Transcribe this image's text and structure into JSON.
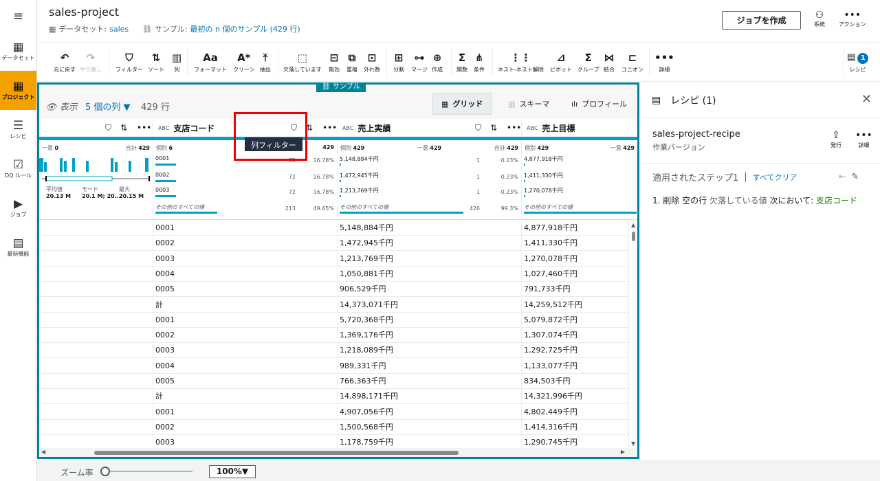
{
  "nav": {
    "items": [
      {
        "icon": "▦",
        "label": "データセット"
      },
      {
        "icon": "▦",
        "label": "プロジェクト"
      },
      {
        "icon": "☰",
        "label": "レシピ"
      },
      {
        "icon": "☑",
        "label": "DQ ルール"
      },
      {
        "icon": "▶",
        "label": "ジョブ"
      },
      {
        "icon": "▤",
        "label": "最新機能"
      }
    ]
  },
  "header": {
    "title": "sales-project",
    "dataset_label": "データセット:",
    "dataset_value": "sales",
    "sample_label": "サンプル:",
    "sample_value": "最初の n 個のサンプル (429 行)",
    "create_job": "ジョブを作成",
    "lineage": "系統",
    "actions": "アクション"
  },
  "toolbar": {
    "items": [
      {
        "icon": "↶",
        "label": "元に戻す"
      },
      {
        "icon": "↷",
        "label": "やり直し"
      },
      {
        "icon": "⛉",
        "label": "フィルター"
      },
      {
        "icon": "⇅",
        "label": "ソート"
      },
      {
        "icon": "▥",
        "label": "列"
      },
      {
        "icon": "Aa",
        "label": "フォーマット"
      },
      {
        "icon": "A*",
        "label": "クリーン"
      },
      {
        "icon": "⤒",
        "label": "抽出"
      },
      {
        "icon": "⬚",
        "label": "欠落しています"
      },
      {
        "icon": "⊟",
        "label": "無効"
      },
      {
        "icon": "⧉",
        "label": "重複"
      },
      {
        "icon": "⊡",
        "label": "外れ数"
      },
      {
        "icon": "⊞",
        "label": "分割"
      },
      {
        "icon": "⊶",
        "label": "マージ"
      },
      {
        "icon": "⊕",
        "label": "作成"
      },
      {
        "icon": "Σ",
        "label": "関数"
      },
      {
        "icon": "⋔",
        "label": "条件"
      },
      {
        "icon": "⋮⋮",
        "label": "ネスト-ネスト解除"
      },
      {
        "icon": "⊿",
        "label": "ピボット"
      },
      {
        "icon": "Σ",
        "label": "グループ"
      },
      {
        "icon": "⋈",
        "label": "結合"
      },
      {
        "icon": "⊏",
        "label": "ユニオン"
      },
      {
        "icon": "•••",
        "label": "詳細"
      }
    ],
    "recipe_label": "レシピ",
    "recipe_count": "1"
  },
  "sample_tag": "サンプル",
  "view": {
    "show": "表示",
    "columns": "5 個の列 ▼",
    "rows": "429 行",
    "tabs": [
      "グリッド",
      "スキーマ",
      "プロフィール"
    ]
  },
  "columns": [
    {
      "name": "",
      "type": ""
    },
    {
      "name": "支店コード",
      "type": "ABC"
    },
    {
      "name": "売上実績",
      "type": "ABC"
    },
    {
      "name": "売上目標",
      "type": "ABC"
    }
  ],
  "stats": {
    "col0": {
      "unique_label": "一意",
      "unique": "0",
      "total_label": "合計",
      "total": "429",
      "avg_label": "平均値",
      "avg": "20.13 M",
      "mode_label": "モード",
      "mode": "20.1 M; 20....",
      "max_label": "最大",
      "max": "20.15 M"
    },
    "col1": {
      "distinct_label": "個別",
      "distinct": "6",
      "unique_label": "一",
      "total": "429",
      "values": [
        {
          "v": "0001",
          "c": "72",
          "p": "16.78%",
          "w": 30
        },
        {
          "v": "0002",
          "c": "72",
          "p": "16.78%",
          "w": 30
        },
        {
          "v": "0003",
          "c": "72",
          "p": "16.78%",
          "w": 30
        },
        {
          "v": "その他のすべての値",
          "c": "213",
          "p": "49.65%",
          "w": 90
        }
      ]
    },
    "col2": {
      "distinct_label": "個別",
      "distinct": "429",
      "unique_label": "一意",
      "unique": "429",
      "total_label": "合計",
      "total": "429",
      "values": [
        {
          "v": "5,148,884千円",
          "c": "1",
          "p": "0.23%",
          "w": 2
        },
        {
          "v": "1,472,945千円",
          "c": "1",
          "p": "0.23%",
          "w": 2
        },
        {
          "v": "1,213,769千円",
          "c": "1",
          "p": "0.23%",
          "w": 2
        },
        {
          "v": "その他のすべての値",
          "c": "426",
          "p": "99.3%",
          "w": 180
        }
      ]
    },
    "col3": {
      "distinct_label": "個別",
      "distinct": "429",
      "unique_label": "一意",
      "unique": "429",
      "values": [
        {
          "v": "4,877,918千円"
        },
        {
          "v": "1,411,330千円"
        },
        {
          "v": "1,270,078千円"
        },
        {
          "v": "その他のすべての値"
        }
      ]
    }
  },
  "rows": [
    [
      "0001",
      "5,148,884千円",
      "4,877,918千円"
    ],
    [
      "0002",
      "1,472,945千円",
      "1,411,330千円"
    ],
    [
      "0003",
      "1,213,769千円",
      "1,270,078千円"
    ],
    [
      "0004",
      "1,050,881千円",
      "1,027,460千円"
    ],
    [
      "0005",
      "906,529千円",
      "791,733千円"
    ],
    [
      "計",
      "14,373,071千円",
      "14,259,512千円"
    ],
    [
      "0001",
      "5,720,368千円",
      "5,079,872千円"
    ],
    [
      "0002",
      "1,369,176千円",
      "1,307,074千円"
    ],
    [
      "0003",
      "1,218,089千円",
      "1,292,725千円"
    ],
    [
      "0004",
      "989,331千円",
      "1,133,077千円"
    ],
    [
      "0005",
      "766,363千円",
      "834,503千円"
    ],
    [
      "計",
      "14,898,171千円",
      "14,321,996千円"
    ],
    [
      "0001",
      "4,907,056千円",
      "4,802,449千円"
    ],
    [
      "0002",
      "1,500,568千円",
      "1,414,316千円"
    ],
    [
      "0003",
      "1,178,759千円",
      "1,290,745千円"
    ]
  ],
  "tooltip": "列フィルター",
  "recipe": {
    "title": "レシピ (1)",
    "name": "sales-project-recipe",
    "version": "作業バージョン",
    "publish": "発行",
    "details": "詳細",
    "applied": "適用されたステップ1",
    "clear": "すべてクリア",
    "step_num": "1.",
    "step_action": "削除",
    "step_obj": "空の行",
    "step_missing": "欠落している値",
    "step_in": "次において:",
    "step_col": "支店コード"
  },
  "footer": {
    "zoom_label": "ズーム率",
    "zoom_value": "100%▼",
    "zoom_level": 0
  }
}
